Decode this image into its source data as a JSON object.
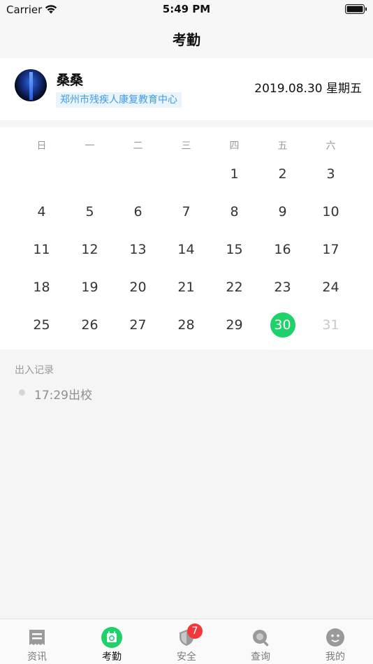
{
  "status_bar": {
    "carrier": "Carrier",
    "time": "5:49 PM"
  },
  "nav": {
    "title": "考勤"
  },
  "profile": {
    "name": "桑桑",
    "org": "郑州市残疾人康复教育中心",
    "date": "2019.08.30 星期五"
  },
  "calendar": {
    "weekdays": [
      "日",
      "一",
      "二",
      "三",
      "四",
      "五",
      "六"
    ],
    "first_weekday_index": 4,
    "days": [
      "1",
      "2",
      "3",
      "4",
      "5",
      "6",
      "7",
      "8",
      "9",
      "10",
      "11",
      "12",
      "13",
      "14",
      "15",
      "16",
      "17",
      "18",
      "19",
      "20",
      "21",
      "22",
      "23",
      "24",
      "25",
      "26",
      "27",
      "28",
      "29",
      "30",
      "31"
    ],
    "selected_day": "30",
    "dimmed_days": [
      "31"
    ],
    "accent_color": "#1ed26a"
  },
  "records": {
    "title": "出入记录",
    "items": [
      "17:29出校"
    ]
  },
  "tab_bar": {
    "tabs": [
      {
        "label": "资讯",
        "icon": "news-icon"
      },
      {
        "label": "考勤",
        "icon": "attendance-icon"
      },
      {
        "label": "安全",
        "icon": "shield-icon",
        "badge": "7"
      },
      {
        "label": "查询",
        "icon": "search-icon"
      },
      {
        "label": "我的",
        "icon": "profile-icon"
      }
    ],
    "active_index": 1
  }
}
